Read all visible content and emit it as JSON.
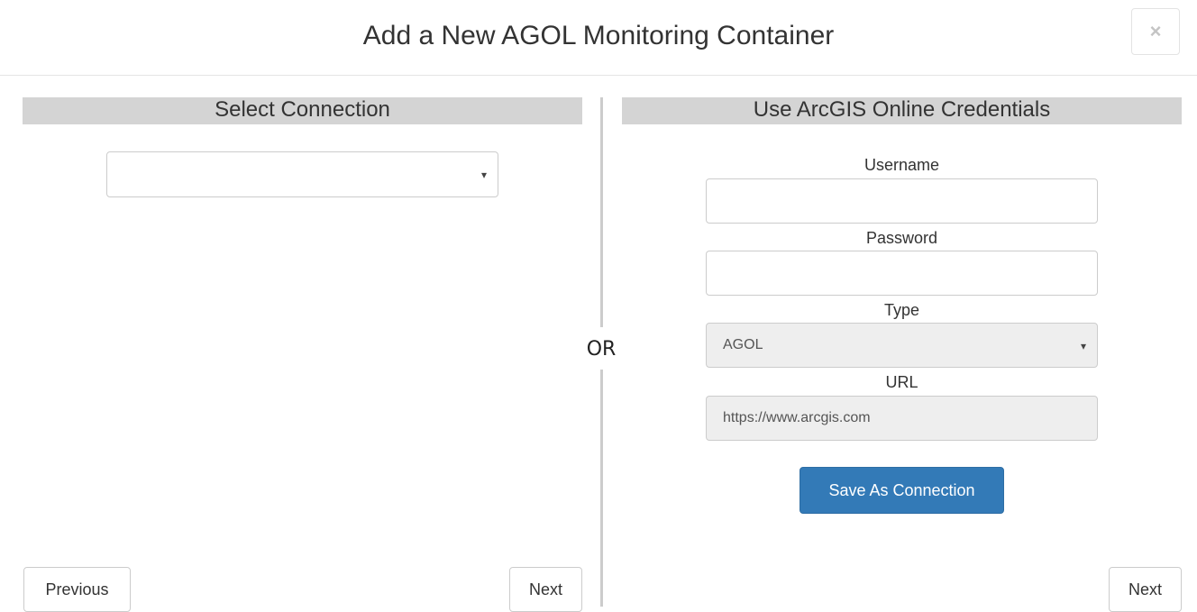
{
  "modal": {
    "title": "Add a New AGOL Monitoring Container",
    "close_symbol": "×"
  },
  "left_panel": {
    "header": "Select Connection",
    "connection_select": {
      "selected_value": ""
    },
    "previous_label": "Previous",
    "next_label": "Next"
  },
  "divider": {
    "label": "OR"
  },
  "right_panel": {
    "header": "Use ArcGIS Online Credentials",
    "username": {
      "label": "Username",
      "value": ""
    },
    "password": {
      "label": "Password",
      "value": ""
    },
    "type": {
      "label": "Type",
      "selected_value": "AGOL"
    },
    "url": {
      "label": "URL",
      "value": "https://www.arcgis.com"
    },
    "save_label": "Save As Connection",
    "next_label": "Next"
  },
  "icons": {
    "dropdown_caret": "▾",
    "close": "×"
  },
  "colors": {
    "primary_button": "#337ab7",
    "section_header_bg": "#d4d4d4",
    "readonly_bg": "#eeeeee"
  }
}
